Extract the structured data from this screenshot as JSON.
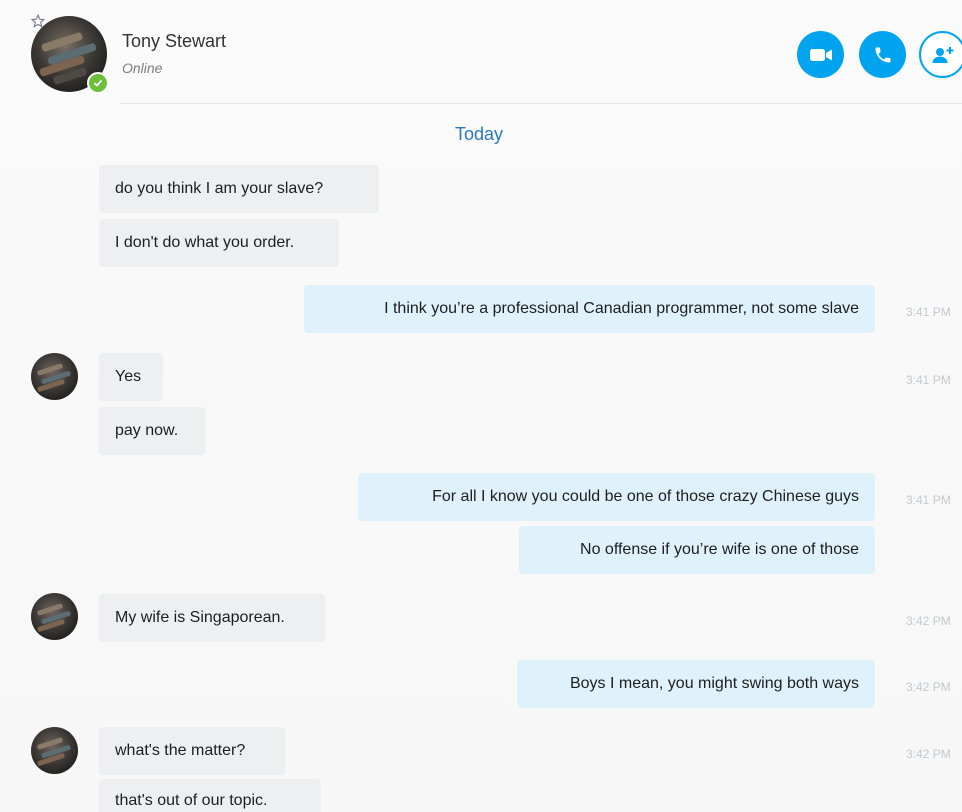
{
  "header": {
    "contact_name": "Tony Stewart",
    "contact_status": "Online",
    "icons": [
      "star-icon",
      "online-status-icon",
      "video-call-icon",
      "audio-call-icon",
      "add-people-icon"
    ]
  },
  "conversation": {
    "day_label": "Today",
    "messages": [
      {
        "direction": "incoming",
        "text": "do you think I am your slave?"
      },
      {
        "direction": "incoming",
        "text": "I don't do what you order."
      },
      {
        "direction": "outgoing",
        "text": "I think you’re a professional Canadian programmer, not some slave",
        "time": "3:41 PM"
      },
      {
        "direction": "incoming",
        "text": "Yes",
        "time": "3:41 PM"
      },
      {
        "direction": "incoming",
        "text": "pay now."
      },
      {
        "direction": "outgoing",
        "text": "For all I know you could be one of those crazy Chinese guys",
        "time": "3:41 PM"
      },
      {
        "direction": "outgoing",
        "text": "No offense if you’re wife is one of those"
      },
      {
        "direction": "incoming",
        "text": "My wife is Singaporean.",
        "time": "3:42 PM"
      },
      {
        "direction": "outgoing",
        "text": "Boys I mean, you might swing both ways",
        "time": "3:42 PM"
      },
      {
        "direction": "incoming",
        "text": "what's the matter?",
        "time": "3:42 PM"
      },
      {
        "direction": "incoming",
        "text": "that's out of our topic."
      }
    ]
  },
  "colors": {
    "accent": "#00a3ee",
    "online": "#6cbf3b",
    "incoming_bubble": "#eeeff1",
    "outgoing_bubble": "#dff2fc",
    "day_label": "#2a79c0"
  }
}
